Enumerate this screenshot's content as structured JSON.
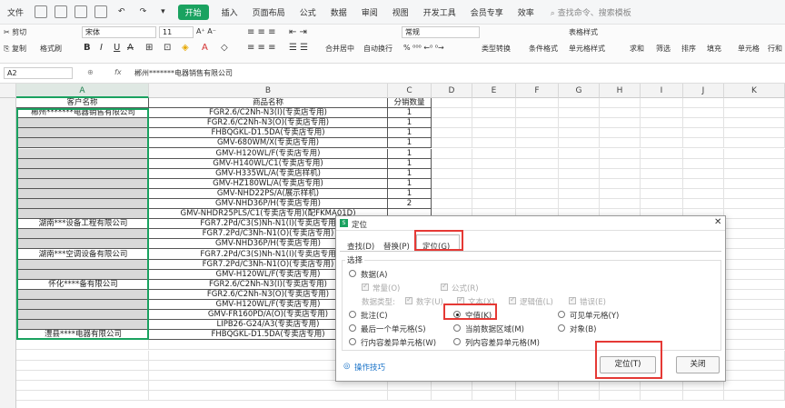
{
  "menubar": {
    "file": "文件",
    "start": "开始",
    "tabs": [
      "插入",
      "页面布局",
      "公式",
      "数据",
      "审阅",
      "视图",
      "开发工具",
      "会员专享",
      "效率"
    ],
    "search": "查找命令、搜索模板"
  },
  "ribbon": {
    "cut": "剪切",
    "copy": "复制",
    "format_painter": "格式刷",
    "font_name": "宋体",
    "font_size": "11",
    "merge": "合并居中",
    "wrap": "自动换行",
    "number_format": "常规",
    "type_convert": "类型转换",
    "cond_format": "条件格式",
    "table_style": "表格样式",
    "cell_style": "单元格样式",
    "sum": "求和",
    "filter": "筛选",
    "sort": "排序",
    "fill": "填充",
    "cell": "单元格",
    "row_col": "行和"
  },
  "formula_bar": {
    "name_box": "A2",
    "fx": "fx",
    "content": "郴州*******电器销售有限公司"
  },
  "columns": [
    "A",
    "B",
    "C",
    "D",
    "E",
    "F",
    "G",
    "H",
    "I",
    "J",
    "K"
  ],
  "header_row": {
    "a": "客户名称",
    "b": "商品名称",
    "c": "分销数量"
  },
  "rows": [
    {
      "a": "郴州*******电器销售有限公司",
      "b": "FGR2.6/C2Nh-N3(I)(专卖店专用)",
      "c": "1"
    },
    {
      "a": "",
      "b": "FGR2.6/C2Nh-N3(O)(专卖店专用)",
      "c": "1"
    },
    {
      "a": "",
      "b": "FHBQGKL-D1.5DA(专卖店专用)",
      "c": "1"
    },
    {
      "a": "",
      "b": "GMV-680WM/X(专卖店专用)",
      "c": "1"
    },
    {
      "a": "",
      "b": "GMV-H120WL/F(专卖店专用)",
      "c": "1"
    },
    {
      "a": "",
      "b": "GMV-H140WL/C1(专卖店专用)",
      "c": "1"
    },
    {
      "a": "",
      "b": "GMV-H335WL/A(专卖店样机)",
      "c": "1"
    },
    {
      "a": "",
      "b": "GMV-HZ180WL/A(专卖店专用)",
      "c": "1"
    },
    {
      "a": "",
      "b": "GMV-NHD22PS/A(展示样机)",
      "c": "1"
    },
    {
      "a": "",
      "b": "GMV-NHD36P/H(专卖店专用)",
      "c": "2"
    },
    {
      "a": "",
      "b": "GMV-NHDR25PLS/C1(专卖店专用)(配FKMA01D)",
      "c": ""
    },
    {
      "a": "湖南***设备工程有限公司",
      "b": "FGR7.2Pd/C3(S)Nh-N1(I)(专卖店专用",
      "c": ""
    },
    {
      "a": "",
      "b": "FGR7.2Pd/C3Nh-N1(O)(专卖店专用)",
      "c": ""
    },
    {
      "a": "",
      "b": "GMV-NHD36P/H(专卖店专用)",
      "c": ""
    },
    {
      "a": "湖南***空调设备有限公司",
      "b": "FGR7.2Pd/C3(S)Nh-N1(I)(专卖店专用",
      "c": ""
    },
    {
      "a": "",
      "b": "FGR7.2Pd/C3Nh-N1(O)(专卖店专用)",
      "c": ""
    },
    {
      "a": "",
      "b": "GMV-H120WL/F(专卖店专用)",
      "c": ""
    },
    {
      "a": "怀化****备有限公司",
      "b": "FGR2.6/C2Nh-N3(I)(专卖店专用)",
      "c": ""
    },
    {
      "a": "",
      "b": "FGR2.6/C2Nh-N3(O)(专卖店专用)",
      "c": ""
    },
    {
      "a": "",
      "b": "GMV-H120WL/F(专卖店专用)",
      "c": ""
    },
    {
      "a": "",
      "b": "GMV-FR160PD/A(O)(专卖店专用)",
      "c": ""
    },
    {
      "a": "",
      "b": "LIPB26-G24/A3(专卖店专用)",
      "c": ""
    },
    {
      "a": "澧县****电器有限公司",
      "b": "FHBQGKL-D1.5DA(专卖店专用)",
      "c": ""
    }
  ],
  "dialog": {
    "title": "定位",
    "tabs": [
      "查找(D)",
      "替换(P)",
      "定位(G)"
    ],
    "group_label": "选择",
    "data": "数据(A)",
    "constant": "常量(O)",
    "formula": "公式(R)",
    "data_type": "数据类型:",
    "digit": "数字(U)",
    "text": "文本(X)",
    "logic": "逻辑值(L)",
    "error": "错误(E)",
    "comment": "批注(C)",
    "blank": "空值(K)",
    "visible": "可见单元格(Y)",
    "last_cell": "最后一个单元格(S)",
    "current_region": "当前数据区域(M)",
    "object": "对象(B)",
    "row_diff": "行内容差异单元格(W)",
    "col_diff": "列内容差异单元格(M)",
    "tips": "操作技巧",
    "ok": "定位(T)",
    "close": "关闭"
  }
}
